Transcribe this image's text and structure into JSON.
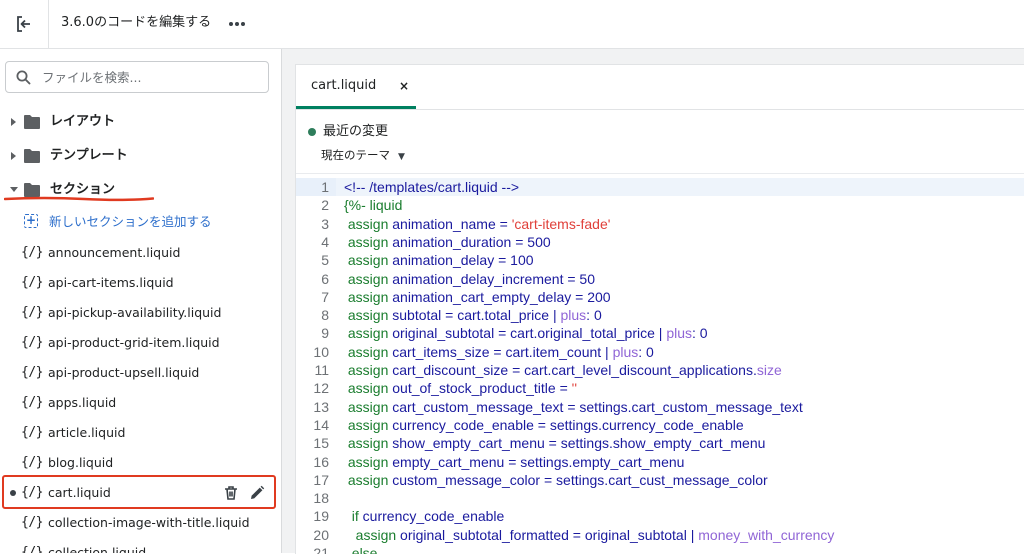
{
  "header": {
    "title": "3.6.0のコードを編集する",
    "more_icon": "more-horizontal-icon",
    "exit_icon": "exit-icon"
  },
  "sidebar": {
    "search_placeholder": "ファイルを検索...",
    "folders": [
      {
        "label": "レイアウト",
        "expanded": false
      },
      {
        "label": "テンプレート",
        "expanded": false
      },
      {
        "label": "セクション",
        "expanded": true
      }
    ],
    "add_section_label": "新しいセクションを追加する",
    "file_icon_glyph": "{/}",
    "files": [
      {
        "name": "announcement.liquid"
      },
      {
        "name": "api-cart-items.liquid"
      },
      {
        "name": "api-pickup-availability.liquid"
      },
      {
        "name": "api-product-grid-item.liquid"
      },
      {
        "name": "api-product-upsell.liquid"
      },
      {
        "name": "apps.liquid"
      },
      {
        "name": "article.liquid"
      },
      {
        "name": "blog.liquid"
      },
      {
        "name": "cart.liquid",
        "selected": true
      },
      {
        "name": "collection-image-with-title.liquid"
      },
      {
        "name": "collection.liquid"
      }
    ]
  },
  "editor": {
    "tab_label": "cart.liquid",
    "tab_close": "×",
    "recent_changes_label": "最近の変更",
    "theme_select_value": "現在のテーマ",
    "accent_color": "#008060",
    "lines": [
      {
        "n": "1",
        "tokens": [
          [
            "cmt",
            "<!-- /templates/cart.liquid -->"
          ]
        ]
      },
      {
        "n": "2",
        "tokens": [
          [
            "kw",
            "{%- liquid"
          ]
        ]
      },
      {
        "n": "3",
        "tokens": [
          [
            "kw",
            " assign"
          ],
          [
            "var",
            " animation_name = "
          ],
          [
            "str",
            "'cart-items-fade'"
          ]
        ]
      },
      {
        "n": "4",
        "tokens": [
          [
            "kw",
            " assign"
          ],
          [
            "var",
            " animation_duration = 500"
          ]
        ]
      },
      {
        "n": "5",
        "tokens": [
          [
            "kw",
            " assign"
          ],
          [
            "var",
            " animation_delay = 100"
          ]
        ]
      },
      {
        "n": "6",
        "tokens": [
          [
            "kw",
            " assign"
          ],
          [
            "var",
            " animation_delay_increment = 50"
          ]
        ]
      },
      {
        "n": "7",
        "tokens": [
          [
            "kw",
            " assign"
          ],
          [
            "var",
            " animation_cart_empty_delay = 200"
          ]
        ]
      },
      {
        "n": "8",
        "tokens": [
          [
            "kw",
            " assign"
          ],
          [
            "var",
            " subtotal = cart.total_price | "
          ],
          [
            "flt",
            "plus"
          ],
          [
            "var",
            ": 0"
          ]
        ]
      },
      {
        "n": "9",
        "tokens": [
          [
            "kw",
            " assign"
          ],
          [
            "var",
            " original_subtotal = cart.original_total_price | "
          ],
          [
            "flt",
            "plus"
          ],
          [
            "var",
            ": 0"
          ]
        ]
      },
      {
        "n": "10",
        "tokens": [
          [
            "kw",
            " assign"
          ],
          [
            "var",
            " cart_items_size = cart.item_count | "
          ],
          [
            "flt",
            "plus"
          ],
          [
            "var",
            ": 0"
          ]
        ]
      },
      {
        "n": "11",
        "tokens": [
          [
            "kw",
            " assign"
          ],
          [
            "var",
            " cart_discount_size = cart.cart_level_discount_applications."
          ],
          [
            "flt",
            "size"
          ]
        ]
      },
      {
        "n": "12",
        "tokens": [
          [
            "kw",
            " assign"
          ],
          [
            "var",
            " out_of_stock_product_title = "
          ],
          [
            "str",
            "''"
          ]
        ]
      },
      {
        "n": "13",
        "tokens": [
          [
            "kw",
            " assign"
          ],
          [
            "var",
            " cart_custom_message_text = settings.cart_custom_message_text"
          ]
        ]
      },
      {
        "n": "14",
        "tokens": [
          [
            "kw",
            " assign"
          ],
          [
            "var",
            " currency_code_enable = settings.currency_code_enable"
          ]
        ]
      },
      {
        "n": "15",
        "tokens": [
          [
            "kw",
            " assign"
          ],
          [
            "var",
            " show_empty_cart_menu = settings.show_empty_cart_menu"
          ]
        ]
      },
      {
        "n": "16",
        "tokens": [
          [
            "kw",
            " assign"
          ],
          [
            "var",
            " empty_cart_menu = settings.empty_cart_menu"
          ]
        ]
      },
      {
        "n": "17",
        "tokens": [
          [
            "kw",
            " assign"
          ],
          [
            "var",
            " custom_message_color = settings.cart_cust_message_color"
          ]
        ]
      },
      {
        "n": "18",
        "tokens": []
      },
      {
        "n": "19",
        "tokens": [
          [
            "kw",
            "  if"
          ],
          [
            "var",
            " currency_code_enable"
          ]
        ]
      },
      {
        "n": "20",
        "tokens": [
          [
            "kw",
            "   assign"
          ],
          [
            "var",
            " original_subtotal_formatted = original_subtotal | "
          ],
          [
            "flt",
            "money_with_currency"
          ]
        ]
      },
      {
        "n": "21",
        "tokens": [
          [
            "kw",
            "  else"
          ]
        ]
      }
    ]
  }
}
